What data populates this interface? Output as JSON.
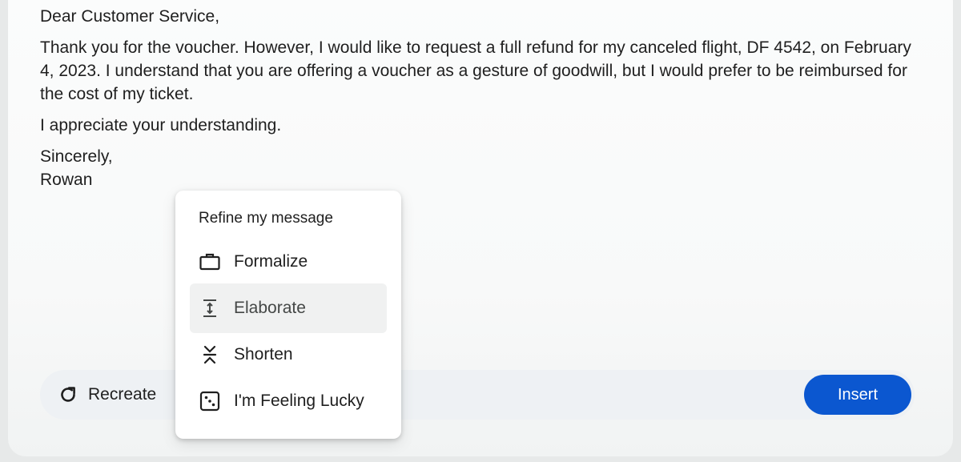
{
  "email": {
    "greeting": "Dear Customer Service,",
    "paragraph1": "Thank you for the voucher. However, I would like to request a full refund for my canceled flight, DF 4542, on February 4, 2023. I understand that you are offering a voucher as a gesture of goodwill, but I would prefer to be reimbursed for the cost of my ticket.",
    "paragraph2": "I appreciate your understanding.",
    "closing": "Sincerely,",
    "signature": "Rowan"
  },
  "refine_menu": {
    "title": "Refine my message",
    "items": [
      {
        "label": "Formalize",
        "icon": "briefcase-icon"
      },
      {
        "label": "Elaborate",
        "icon": "expand-text-icon",
        "highlighted": true
      },
      {
        "label": "Shorten",
        "icon": "shorten-icon"
      },
      {
        "label": "I'm Feeling Lucky",
        "icon": "dice-icon"
      }
    ]
  },
  "actions": {
    "recreate_label": "Recreate",
    "recreate_icon": "refresh-icon",
    "insert_label": "Insert"
  },
  "colors": {
    "primary": "#0b57d0",
    "text": "#1f1f1f",
    "bar_background": "#eef1f4",
    "menu_hover": "#f0f1f1"
  }
}
